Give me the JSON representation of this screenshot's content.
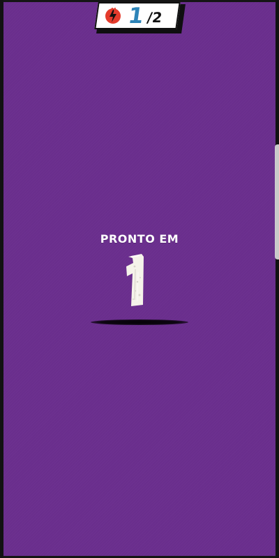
{
  "hud": {
    "icon_name": "lightning-badge-icon",
    "score_current": "1",
    "score_total": "/2"
  },
  "countdown": {
    "label": "PRONTO EM",
    "value": "1"
  },
  "colors": {
    "background": "#6a2e8d",
    "accent_blue": "#2d84b8",
    "accent_red": "#e43b2c",
    "text_light": "#ffffff",
    "text_dark": "#111111"
  }
}
